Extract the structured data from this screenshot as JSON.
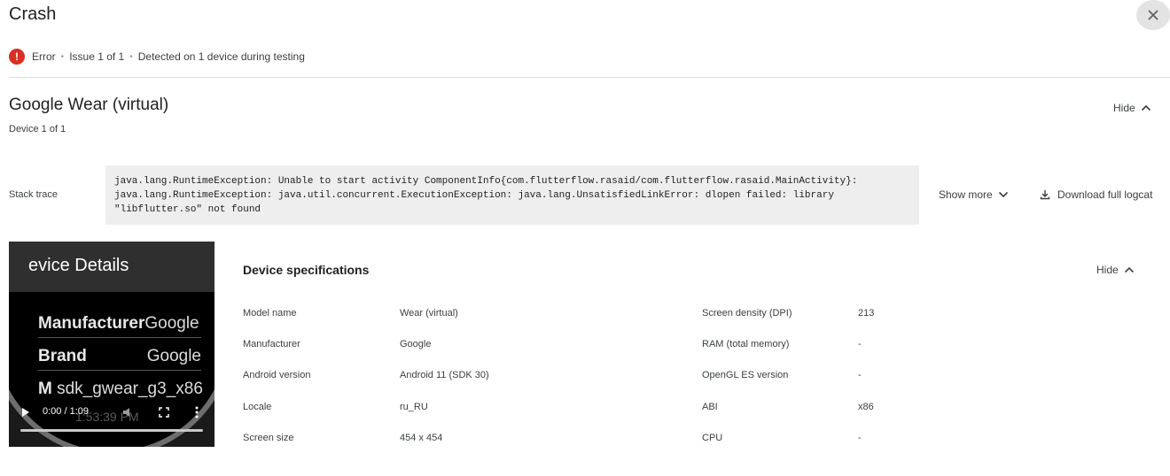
{
  "header": {
    "title": "Crash"
  },
  "summary": {
    "severity": "Error",
    "issue": "Issue 1 of 1",
    "detected": "Detected on 1 device during testing"
  },
  "device": {
    "title": "Google Wear (virtual)",
    "subtitle": "Device 1 of 1",
    "hide_label": "Hide"
  },
  "stack_trace": {
    "label": "Stack trace",
    "lines": [
      "java.lang.RuntimeException: Unable to start activity ComponentInfo{com.flutterflow.rasaid/com.flutterflow.rasaid.MainActivity}:",
      "java.lang.RuntimeException: java.util.concurrent.ExecutionException: java.lang.UnsatisfiedLinkError: dlopen failed: library",
      "\"libflutter.so\" not found"
    ],
    "show_more": "Show more",
    "download": "Download full logcat"
  },
  "video": {
    "screen_title": "evice Details",
    "rows": [
      {
        "label": "Manufacturer",
        "value": "Google"
      },
      {
        "label": "Brand",
        "value": "Google"
      },
      {
        "label": "M",
        "value": "sdk_gwear_g3_x86"
      }
    ],
    "ghost_time": "1:53:39 PM",
    "time": "0:00 / 1:09",
    "progress": 0
  },
  "specs": {
    "title": "Device specifications",
    "hide_label": "Hide",
    "left": [
      {
        "label": "Model name",
        "value": "Wear (virtual)"
      },
      {
        "label": "Manufacturer",
        "value": "Google"
      },
      {
        "label": "Android version",
        "value": "Android 11 (SDK 30)"
      },
      {
        "label": "Locale",
        "value": "ru_RU"
      },
      {
        "label": "Screen size",
        "value": "454 x 454"
      }
    ],
    "right": [
      {
        "label": "Screen density (DPI)",
        "value": "213"
      },
      {
        "label": "RAM (total memory)",
        "value": "-"
      },
      {
        "label": "OpenGL ES version",
        "value": "-"
      },
      {
        "label": "ABI",
        "value": "x86"
      },
      {
        "label": "CPU",
        "value": "-"
      }
    ]
  },
  "colors": {
    "error": "#d93025",
    "text": "#202124",
    "secondary": "#3c4043",
    "code_bg": "#eeeeee"
  }
}
